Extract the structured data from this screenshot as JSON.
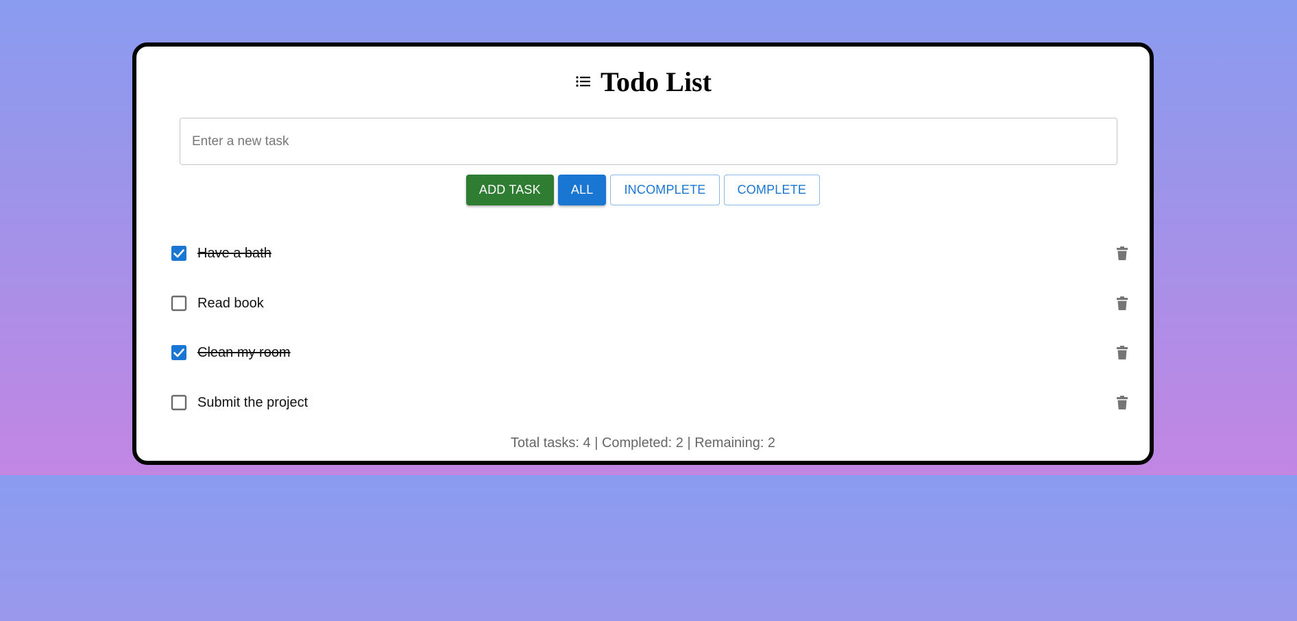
{
  "app": {
    "title": "Todo List",
    "title_icon": "list-icon"
  },
  "input": {
    "placeholder": "Enter a new task",
    "value": ""
  },
  "buttons": {
    "add": "ADD TASK",
    "all": "ALL",
    "incomplete": "INCOMPLETE",
    "complete": "COMPLETE"
  },
  "active_filter": "all",
  "tasks": [
    {
      "text": "Have a bath",
      "completed": true
    },
    {
      "text": "Read book",
      "completed": false
    },
    {
      "text": "Clean my room",
      "completed": true
    },
    {
      "text": "Submit the project",
      "completed": false
    }
  ],
  "stats": {
    "text": "Total tasks: 4 | Completed: 2 | Remaining: 2"
  },
  "colors": {
    "accent": "#1976d2",
    "add_button": "#2e7d32",
    "icon_gray": "#757575"
  }
}
